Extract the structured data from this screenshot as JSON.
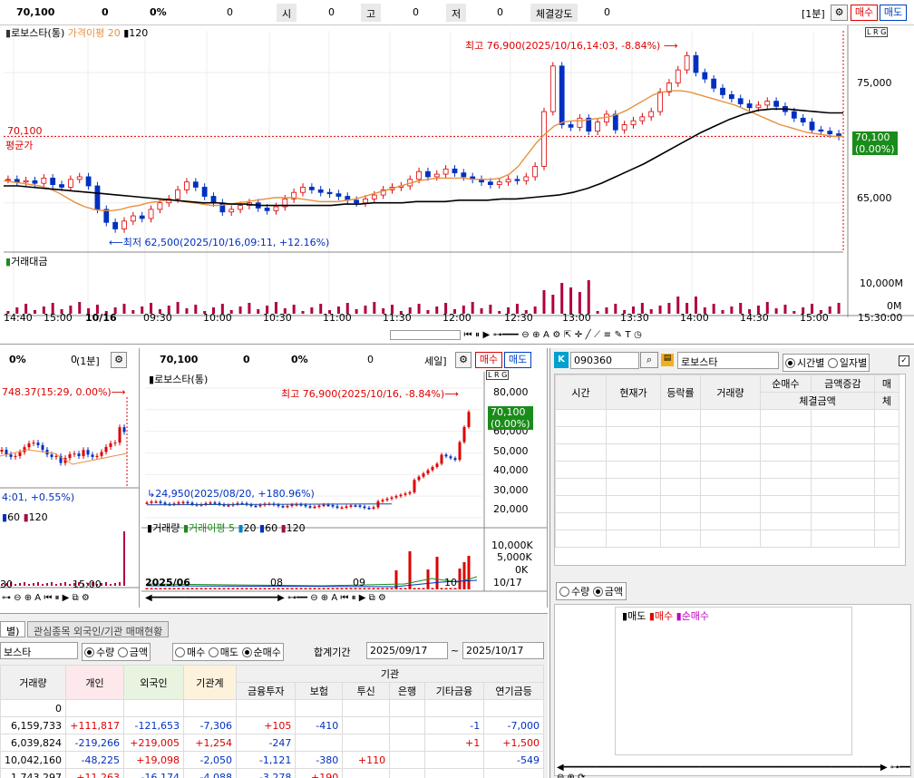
{
  "top": {
    "price": "70,100",
    "change": "0",
    "rate": "0%",
    "volume": "0",
    "open_label": "시",
    "open": "0",
    "high_label": "고",
    "high": "0",
    "low_label": "저",
    "low": "0",
    "strength_label": "체결강도",
    "strength": "0",
    "period": "[1분]",
    "buy": "매수",
    "sell": "매도"
  },
  "main_chart": {
    "title": "로보스타(통)",
    "ma_label": "가격이평 20",
    "ma2": "120",
    "max_text": "최고 76,900(2025/10/16,14:03, -8.84%)",
    "min_text": "최저 62,500(2025/10/16,09:11, +12.16%)",
    "avg_price": "70,100",
    "avg_label": "평균가",
    "right_price": "70,100",
    "right_pct": "(0.00%)",
    "y_ticks": [
      "75,000",
      "70,000",
      "65,000"
    ],
    "vol_label": "거래대금",
    "vol_ticks": [
      "10,000M",
      "0M"
    ],
    "x_ticks": [
      "14:40",
      "15:00",
      "10/16",
      "09:30",
      "10:00",
      "10:30",
      "11:00",
      "11:30",
      "12:00",
      "12:30",
      "13:00",
      "13:30",
      "14:00",
      "14:30",
      "15:00",
      "15:30:00"
    ],
    "lrg": "L R G",
    "chart_data": {
      "type": "candlestick",
      "price_range": [
        62500,
        76900
      ],
      "close_series": [
        66800,
        66600,
        66700,
        66500,
        66900,
        66400,
        66200,
        66800,
        67000,
        66300,
        64500,
        63500,
        63000,
        63600,
        64000,
        63800,
        64500,
        65000,
        65300,
        66000,
        66600,
        66200,
        65500,
        65000,
        64300,
        64500,
        64800,
        65000,
        64600,
        64400,
        64700,
        65300,
        65800,
        66200,
        66000,
        65800,
        65700,
        65500,
        65200,
        65000,
        65300,
        65600,
        66000,
        66200,
        66300,
        66800,
        67400,
        67000,
        67200,
        67600,
        67300,
        67000,
        66800,
        66600,
        66400,
        66600,
        66800,
        66700,
        67000,
        67800,
        72000,
        75500,
        71000,
        70800,
        71500,
        70500,
        71200,
        71800,
        70600,
        71000,
        71300,
        71600,
        72000,
        73500,
        74200,
        75200,
        76300,
        75000,
        74500,
        73800,
        73300,
        73000,
        72600,
        72300,
        72500,
        72800,
        72400,
        72000,
        71500,
        71200,
        70600,
        70500,
        70300,
        70100
      ],
      "ma20": [
        66700,
        66600,
        66500,
        66400,
        66300,
        66100,
        65800,
        65400,
        65000,
        64700,
        64500,
        64400,
        64400,
        64500,
        64700,
        64800,
        65000,
        65100,
        65200,
        65200,
        65100,
        65000,
        64900,
        64800,
        64800,
        64900,
        65000,
        65100,
        65200,
        65300,
        65400,
        65400,
        65400,
        65300,
        65200,
        65100,
        65100,
        65100,
        65200,
        65300,
        65500,
        65700,
        65900,
        66100,
        66300,
        66500,
        66700,
        66800,
        66900,
        66900,
        66900,
        66900,
        66800,
        66800,
        66800,
        66900,
        67200,
        67800,
        68700,
        69600,
        70300,
        70900,
        71200,
        71300,
        71300,
        71400,
        71500,
        71600,
        71800,
        72100,
        72500,
        72900,
        73300,
        73500,
        73600,
        73600,
        73500,
        73300,
        73100,
        72900,
        72700,
        72500,
        72200,
        71900,
        71600,
        71300,
        71000,
        70800,
        70600,
        70400,
        70300,
        70200,
        70100,
        70100
      ],
      "ma120": [
        66300,
        66300,
        66200,
        66100,
        66000,
        65900,
        65800,
        65700,
        65600,
        65500,
        65400,
        65300,
        65200,
        65100,
        65000,
        65000,
        64900,
        64900,
        64800,
        64800,
        64800,
        64800,
        64800,
        64800,
        64900,
        64900,
        65000,
        65000,
        65000,
        65100,
        65100,
        65100,
        65200,
        65200,
        65200,
        65300,
        65300,
        65400,
        65500,
        65600,
        65800,
        66100,
        66500,
        67000,
        67500,
        68000,
        68600,
        69200,
        69800,
        70400,
        70900,
        71400,
        71800,
        72100,
        72200,
        72200,
        72100,
        72000,
        71900,
        71900
      ]
    }
  },
  "sub_left": {
    "rate": "0%",
    "zero": "0",
    "period": "(1분]",
    "max_text": "748.37(15:29, 0.00%)",
    "min_text": "4:01, +0.55%)",
    "legend_a": "60",
    "legend_b": "120",
    "x_ticks": [
      "30",
      "15:00"
    ]
  },
  "sub_mid": {
    "price": "70,100",
    "change": "0",
    "rate": "0%",
    "volume": "0",
    "period": "세일]",
    "buy": "매수",
    "sell": "매도",
    "title": "로보스타(통)",
    "max_text": "최고 76,900(2025/10/16, -8.84%)",
    "min_text": "24,950(2025/08/20, +180.96%)",
    "y_ticks": [
      "80,000",
      "70,000",
      "60,000",
      "50,000",
      "40,000",
      "30,000",
      "20,000"
    ],
    "right_price": "70,100",
    "right_pct": "(0.00%)",
    "vol_label": "거래량",
    "vol_ma": "거래이평 5",
    "vol_a": "20",
    "vol_b": "60",
    "vol_c": "120",
    "vol_ticks": [
      "10,000K",
      "5,000K",
      "0K"
    ],
    "x_ticks": [
      "2025/06",
      "08",
      "09",
      "10",
      "10/17"
    ]
  },
  "right_panel": {
    "code": "090360",
    "name": "로보스타",
    "opt_time": "시간별",
    "opt_day": "일자별",
    "headers": [
      "시간",
      "현재가",
      "등락률",
      "거래량",
      "순매수",
      "금액증감",
      "매"
    ],
    "sub_headers": [
      "체결금액",
      "증감",
      "체"
    ],
    "qty": "수량",
    "amt": "금액",
    "legend": [
      "매도",
      "매수",
      "순매수"
    ]
  },
  "bottom": {
    "tab1": "별)",
    "tab2": "관심종목 외국인/기관 매매현황",
    "stock": "보스타",
    "opt_qty": "수량",
    "opt_amt": "금액",
    "opt_buy": "매수",
    "opt_sell": "매도",
    "opt_net": "순매수",
    "period_label": "합계기간",
    "date_from": "2025/09/17",
    "date_to": "2025/10/17",
    "tilde": "~",
    "headers": [
      "거래량",
      "개인",
      "외국인",
      "기관계",
      "기관",
      "금융투자",
      "보험",
      "투신",
      "은행",
      "기타금융",
      "연기금등"
    ],
    "rows": [
      [
        "0",
        "",
        "",
        "",
        "",
        "",
        "",
        "",
        "",
        ""
      ],
      [
        "6,159,733",
        "+111,817",
        "-121,653",
        "-7,306",
        "+105",
        "-410",
        "",
        "",
        "-1",
        "-7,000"
      ],
      [
        "6,039,824",
        "-219,266",
        "+219,005",
        "+1,254",
        "-247",
        "",
        "",
        "",
        "+1",
        "+1,500"
      ],
      [
        "10,042,160",
        "-48,225",
        "+19,098",
        "-2,050",
        "-1,121",
        "-380",
        "+110",
        "",
        "",
        "-549"
      ],
      [
        "1,743,297",
        "+11,263",
        "-16,174",
        "-4,088",
        "-3,278",
        "+190",
        "",
        "",
        "",
        ""
      ]
    ]
  }
}
